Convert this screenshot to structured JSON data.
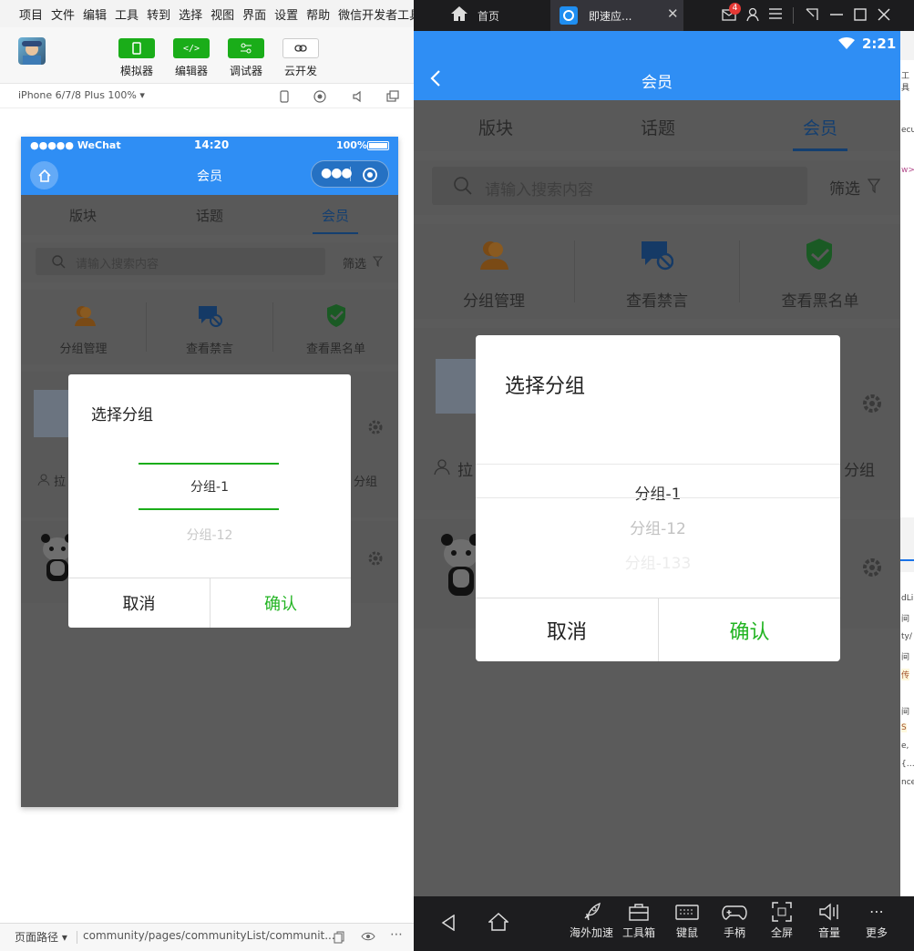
{
  "menu": [
    "项目",
    "文件",
    "编辑",
    "工具",
    "转到",
    "选择",
    "视图",
    "界面",
    "设置",
    "帮助",
    "微信开发者工具"
  ],
  "toolbar": {
    "simulator": "模拟器",
    "editor": "编辑器",
    "debugger": "调试器",
    "cloud": "云开发"
  },
  "device": "iPhone 6/7/8 Plus 100% ▾",
  "sim": {
    "carrier": "●●●●● WeChat",
    "time": "14:20",
    "battery": "100%",
    "title": "会员",
    "tabs": [
      "版块",
      "话题",
      "会员"
    ],
    "search_placeholder": "请输入搜索内容",
    "filter": "筛选",
    "actions": [
      "分组管理",
      "查看禁言",
      "查看黑名单"
    ],
    "row_left": "拉",
    "row_right": "分组"
  },
  "dialog": {
    "title": "选择分组",
    "options": [
      "分组-1",
      "分组-12",
      "分组-133"
    ],
    "cancel": "取消",
    "confirm": "确认"
  },
  "path": {
    "label": "页面路径 ▾",
    "value": "community/pages/communityList/communit..."
  },
  "emu": {
    "home_tab": "首页",
    "app_tab": "即速应...",
    "badge": "4",
    "time": "2:21",
    "title": "会员",
    "tabs": [
      "版块",
      "话题",
      "会员"
    ],
    "search_placeholder": "请输入搜索内容",
    "filter": "筛选",
    "actions": [
      "分组管理",
      "查看禁言",
      "查看黑名单"
    ],
    "row_left": "拉",
    "row_right": "分组"
  },
  "bottom": [
    "海外加速",
    "工具箱",
    "键鼠",
    "手柄",
    "全屏",
    "音量",
    "更多"
  ],
  "edge": [
    "工具",
    "ecu",
    "w>",
    "dLi",
    "间",
    "ty/",
    "间",
    "传",
    "间",
    "S",
    "e,",
    "{…",
    "nce"
  ],
  "colors": {
    "blue": "#2f8ef4",
    "green": "#1aad19",
    "confirm": "#22b422",
    "overlay": "#5b5b5b"
  }
}
